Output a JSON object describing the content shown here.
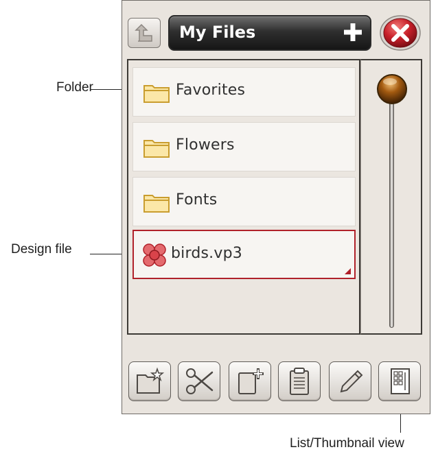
{
  "header": {
    "title": "My Files"
  },
  "items": [
    {
      "label": "Favorites",
      "type": "folder"
    },
    {
      "label": "Flowers",
      "type": "folder"
    },
    {
      "label": "Fonts",
      "type": "folder"
    },
    {
      "label": "birds.vp3",
      "type": "design-file",
      "selected": true
    }
  ],
  "toolbar": [
    {
      "icon": "new-folder-icon"
    },
    {
      "icon": "scissors-icon"
    },
    {
      "icon": "copy-icon"
    },
    {
      "icon": "paste-icon"
    },
    {
      "icon": "rename-pencil-icon"
    },
    {
      "icon": "list-thumbnail-icon"
    }
  ],
  "callouts": {
    "folder": "Folder",
    "design_file": "Design file",
    "view_toggle": "List/Thumbnail view"
  },
  "colors": {
    "selected_border": "#b0212a",
    "folder_icon": "#d9b24a",
    "close_button": "#c8202a"
  }
}
